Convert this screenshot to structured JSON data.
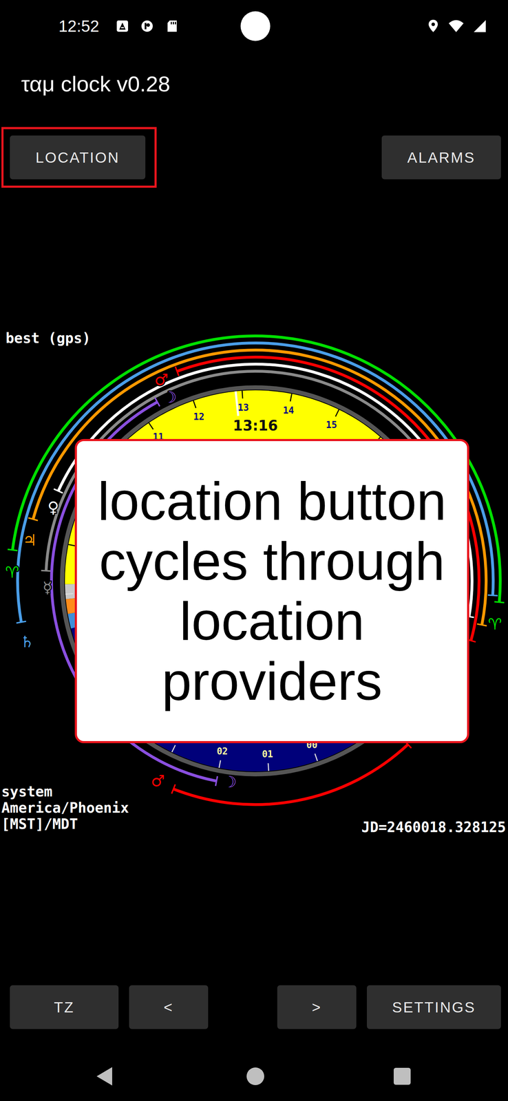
{
  "status_bar": {
    "time": "12:52"
  },
  "app": {
    "title": "ταμ clock v0.28"
  },
  "top_buttons": [
    {
      "label": "LOCATION",
      "highlighted": true
    },
    {
      "label": "ALARMS",
      "highlighted": false
    }
  ],
  "location_provider": "best (gps)",
  "timezone": [
    "system",
    "America/Phoenix",
    "[MST]/MDT"
  ],
  "julian_date": "JD=2460018.328125",
  "callout": "location button cycles through location providers",
  "clock": {
    "time_label": "13:16",
    "hand_hour": 12.87,
    "dial_segments": [
      {
        "from": 6.3,
        "to": 6.6,
        "color": "#3f8fd8"
      },
      {
        "from": 6.6,
        "to": 6.9,
        "color": "#ff8c1a"
      },
      {
        "from": 6.9,
        "to": 7.2,
        "color": "#c8c8c8"
      },
      {
        "from": 7.2,
        "to": 19.0,
        "color": "#ffff00"
      },
      {
        "from": 19.0,
        "to": 19.3,
        "color": "#c8c8c8"
      },
      {
        "from": 19.3,
        "to": 19.6,
        "color": "#ff8c1a"
      },
      {
        "from": 19.6,
        "to": 19.9,
        "color": "#3f8fd8"
      },
      {
        "from": 19.9,
        "to": 30.3,
        "color": "#00007a"
      }
    ],
    "hour_labels": [
      {
        "text": "11",
        "hour": 11
      },
      {
        "text": "12",
        "hour": 12
      },
      {
        "text": "13",
        "hour": 13
      },
      {
        "text": "14",
        "hour": 14
      },
      {
        "text": "15",
        "hour": 15
      },
      {
        "text": "00",
        "hour": 0
      },
      {
        "text": "01",
        "hour": 1
      },
      {
        "text": "02",
        "hour": 2
      }
    ],
    "rings": [
      {
        "name": "aries",
        "color": "#00e000",
        "arcs": [
          [
            7.75,
            19.6
          ]
        ],
        "labels": [
          {
            "text": "♈",
            "hour": 7.4
          },
          {
            "text": "♈",
            "hour": 19.95
          }
        ]
      },
      {
        "name": "saturn",
        "color": "#4a9ee8",
        "arcs": [
          [
            6.6,
            19.5
          ]
        ],
        "labels": [
          {
            "text": "♄",
            "hour": 6.27
          }
        ]
      },
      {
        "name": "jupiter",
        "color": "#ff9900",
        "arcs": [
          [
            8.3,
            20.0
          ]
        ],
        "labels": [
          {
            "text": "♃",
            "hour": 7.95
          }
        ]
      },
      {
        "name": "mars",
        "color": "#ff0000",
        "arcs": [
          [
            11.9,
            20.3
          ],
          [
            22.4,
            26.7
          ]
        ],
        "labels": [
          {
            "text": "♂",
            "hour": 11.6
          },
          {
            "text": "♂",
            "hour": 27.0
          }
        ]
      },
      {
        "name": "venus",
        "color": "#ffffff",
        "arcs": [
          [
            8.9,
            19.9
          ]
        ],
        "labels": [
          {
            "text": "♀",
            "hour": 8.6
          }
        ]
      },
      {
        "name": "mercury",
        "color": "#8a8a8a",
        "arcs": [
          [
            7.45,
            19.7
          ]
        ],
        "labels": [
          {
            "text": "☿",
            "hour": 7.15
          }
        ]
      },
      {
        "name": "moon",
        "color": "#8a4fe0",
        "arcs": [
          [
            2.0,
            11.35
          ]
        ],
        "labels": [
          {
            "text": "☽",
            "hour": 1.75
          },
          {
            "text": "☽",
            "hour": 11.6
          }
        ]
      }
    ]
  },
  "bottom_buttons": [
    {
      "label": "TZ"
    },
    {
      "label": "<"
    },
    {
      "label": ">"
    },
    {
      "label": "SETTINGS"
    }
  ]
}
